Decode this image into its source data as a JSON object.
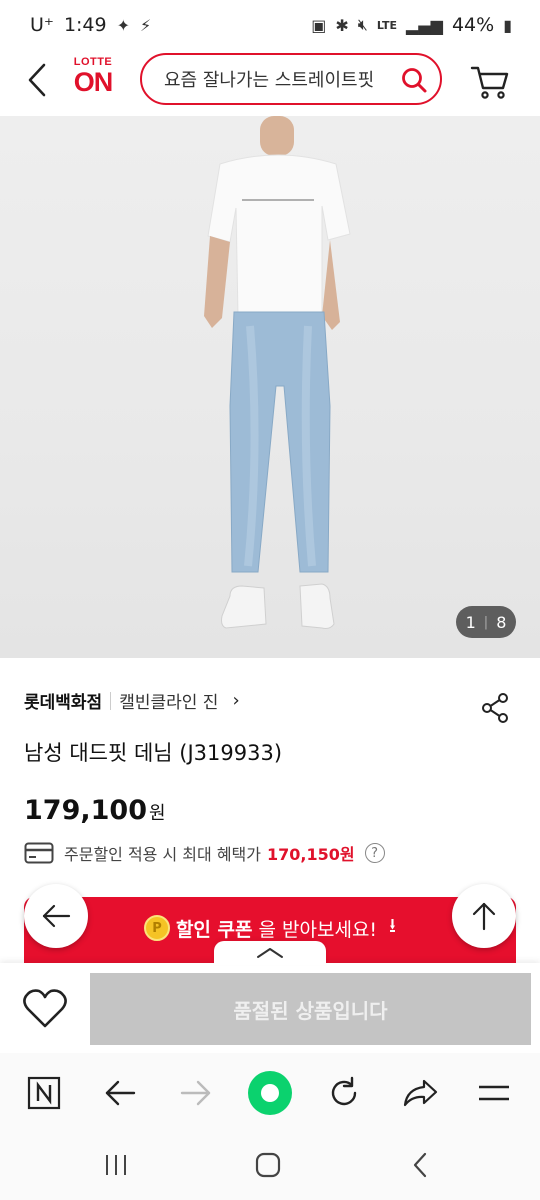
{
  "status_bar": {
    "carrier": "U⁺",
    "time": "1:49",
    "battery": "44%",
    "network": "LTE"
  },
  "header": {
    "logo_top": "LOTTE",
    "logo_main": "ON",
    "search_text": "요즘 잘나가는 스트레이트핏",
    "brand_color": "#e0112b"
  },
  "hero": {
    "image_counter_current": "1",
    "image_counter_total": "8"
  },
  "product": {
    "store": "롯데백화점",
    "brand": "캘빈클라인 진",
    "title": "남성 대드핏 데님 (J319933)",
    "price": "179,100",
    "price_unit": "원",
    "benefit_label": "주문할인 적용 시 최대 혜택가",
    "benefit_price": "170,150원",
    "help_glyph": "?"
  },
  "coupon": {
    "bold_text": "할인 쿠폰",
    "rest_text": "을 받아보세요!",
    "coin_glyph": "P",
    "color": "#e60f2d"
  },
  "purchase": {
    "soldout_label": "품절된 상품입니다"
  },
  "icons": {
    "back": "chevron-left-icon",
    "search": "search-icon",
    "cart": "cart-icon",
    "share": "share-icon",
    "heart": "heart-icon"
  }
}
